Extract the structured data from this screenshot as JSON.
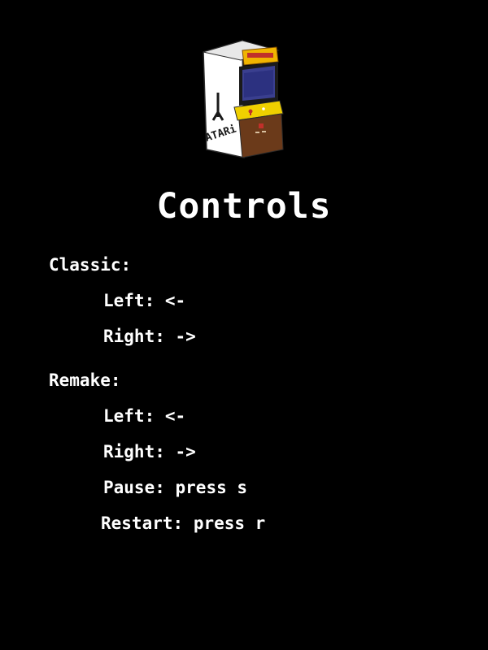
{
  "title": "Controls",
  "cabinet": {
    "brand": "ATARi"
  },
  "sections": [
    {
      "heading": "Classic:",
      "items": [
        {
          "action": "Left",
          "key": "<-"
        },
        {
          "action": "Right",
          "key": "->"
        }
      ]
    },
    {
      "heading": "Remake:",
      "items": [
        {
          "action": "Left",
          "key": "<-"
        },
        {
          "action": "Right",
          "key": "->"
        },
        {
          "action": "Pause",
          "key": "press s"
        },
        {
          "action": "Restart",
          "key": "press r"
        }
      ]
    }
  ],
  "colors": {
    "background": "#000000",
    "text": "#ffffff",
    "marquee": "#f0b400",
    "cabinet_side": "#ffffff",
    "screen": "#3a3f8f",
    "wood": "#6b3a1a"
  },
  "icons": [
    "arcade-cabinet-icon"
  ]
}
